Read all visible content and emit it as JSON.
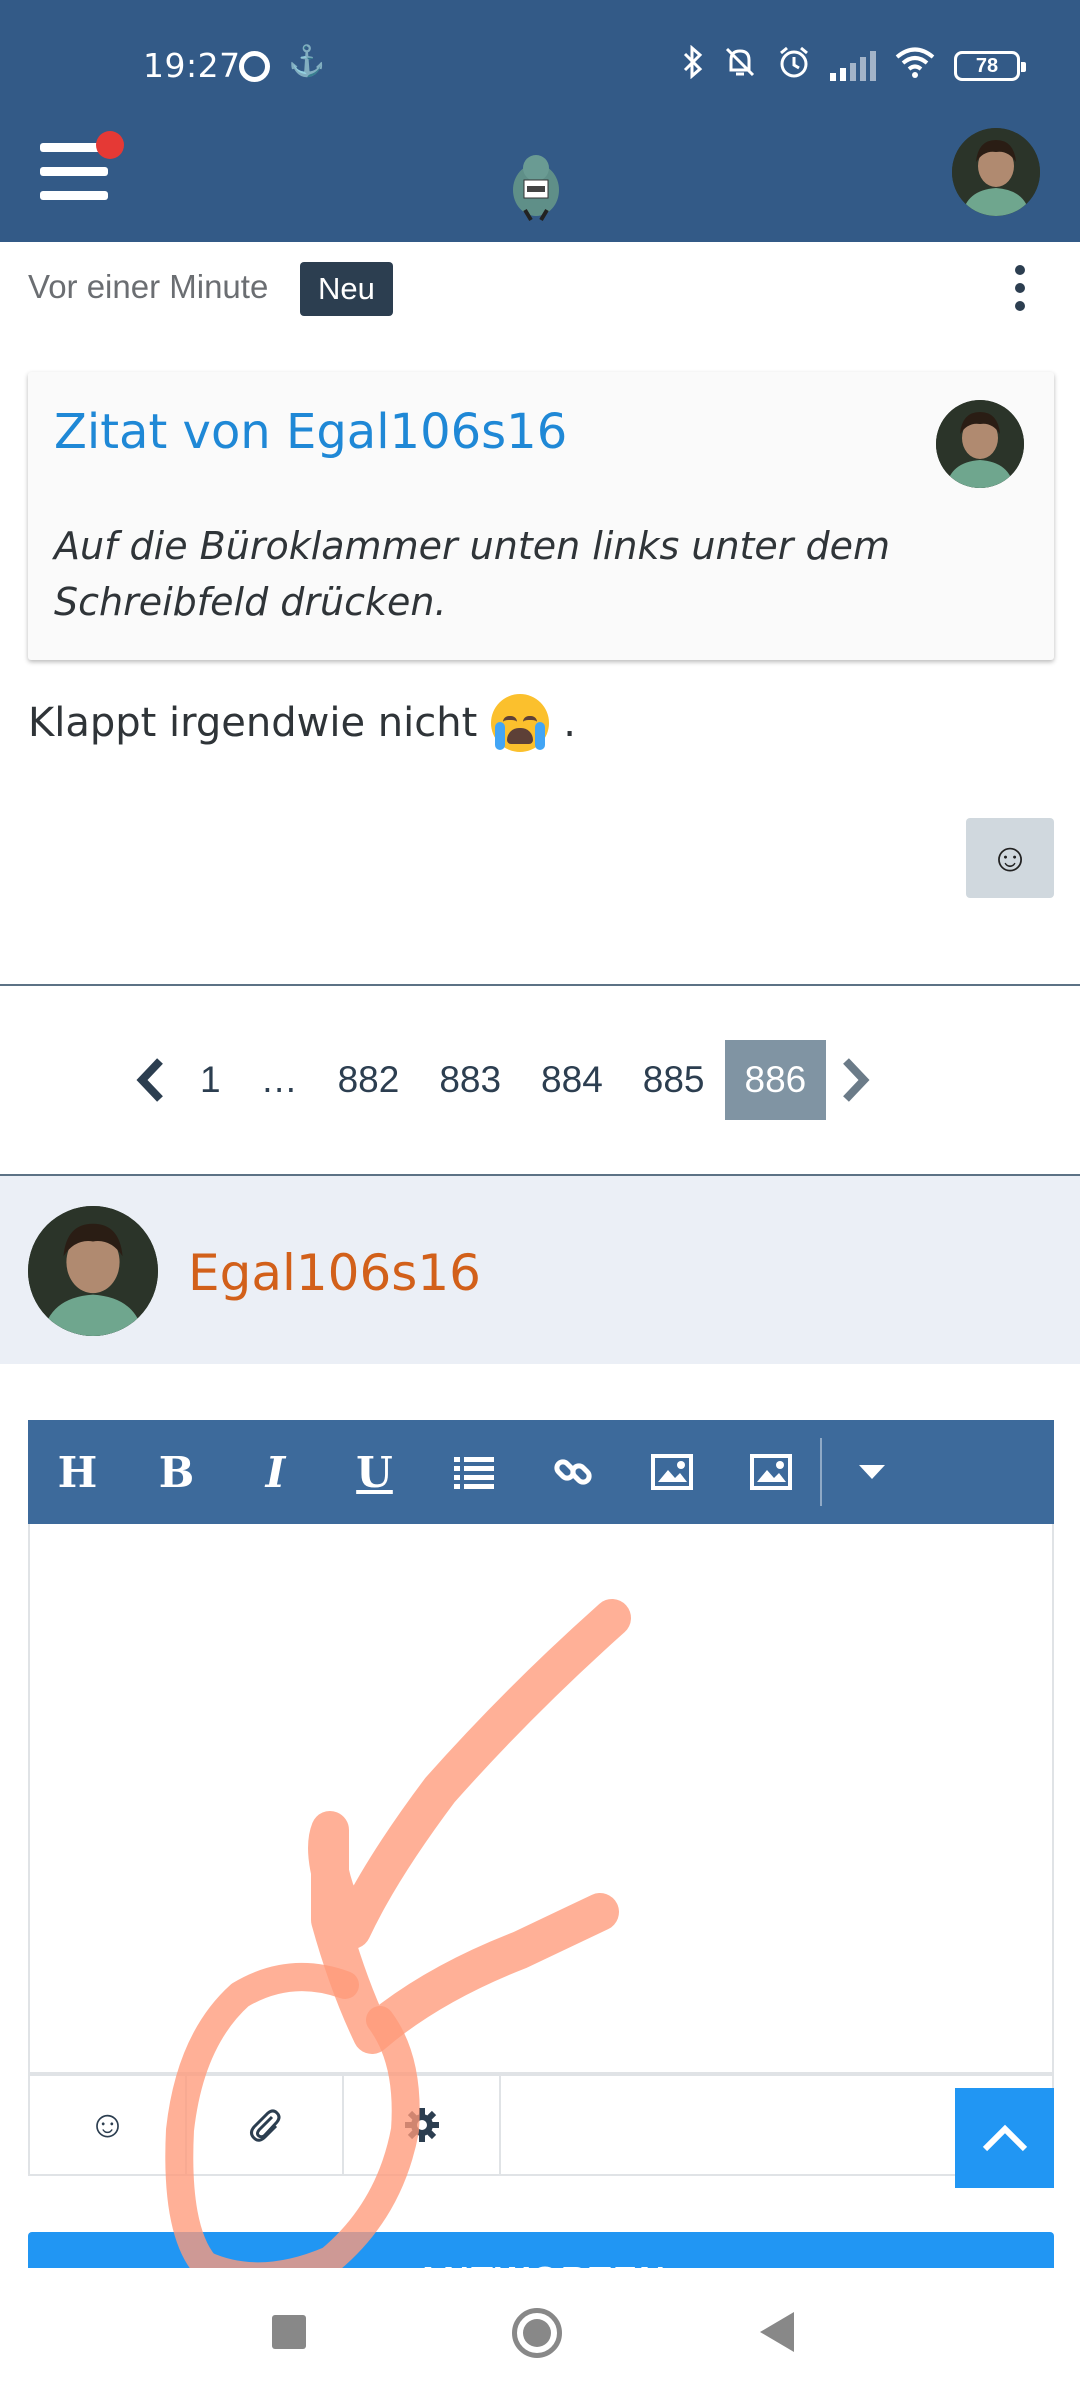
{
  "status_bar": {
    "time": "19:27",
    "battery": "78"
  },
  "post": {
    "time_ago": "Vor einer Minute",
    "badge": "Neu",
    "quote": {
      "title": "Zitat von Egal106s16",
      "text": "Auf die Büroklammer unten links unter dem Schreibfeld drücken."
    },
    "body_text": "Klappt irgendwie nicht",
    "body_suffix": "."
  },
  "pagination": {
    "pages": [
      "1",
      "…",
      "882",
      "883",
      "884",
      "885",
      "886"
    ],
    "current": "886"
  },
  "reply": {
    "author": "Egal106s16",
    "toolbar": {
      "heading": "H",
      "bold": "B",
      "italic": "I",
      "underline": "U"
    },
    "submit_label": "ANTWORTEN"
  },
  "colors": {
    "header_bg": "#335a87",
    "accent_blue": "#1f88d6",
    "author_orange": "#d2601a",
    "annotation_stroke": "#ff9a7a"
  }
}
